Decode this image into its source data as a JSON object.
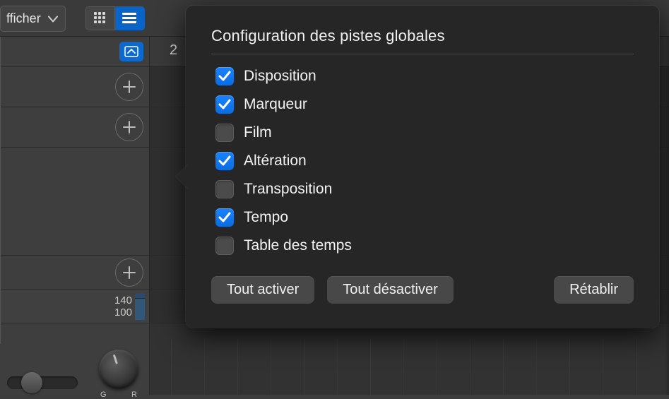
{
  "toolbar": {
    "menu_label": "fficher",
    "grid_view_tooltip": "grid",
    "list_view_tooltip": "list"
  },
  "tracks": {
    "tempo_hi": "140",
    "tempo_lo": "100",
    "pan_left": "G",
    "pan_right": "R"
  },
  "ruler": {
    "stub": "2"
  },
  "popover": {
    "title": "Configuration des pistes globales",
    "options": {
      "disposition": {
        "label": "Disposition",
        "checked": true
      },
      "marqueur": {
        "label": "Marqueur",
        "checked": true
      },
      "film": {
        "label": "Film",
        "checked": false
      },
      "alteration": {
        "label": "Altération",
        "checked": true
      },
      "transposition": {
        "label": "Transposition",
        "checked": false
      },
      "tempo": {
        "label": "Tempo",
        "checked": true
      },
      "table_des_temps": {
        "label": "Table des temps",
        "checked": false
      }
    },
    "buttons": {
      "enable_all": "Tout activer",
      "disable_all": "Tout désactiver",
      "restore": "Rétablir"
    }
  }
}
